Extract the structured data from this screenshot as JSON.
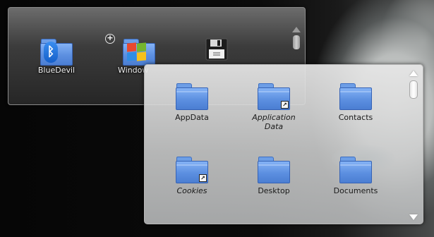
{
  "back_view": {
    "items": [
      {
        "label": "BlueDevil",
        "icon": "bluetooth-folder-icon"
      },
      {
        "label": "Window",
        "icon": "windows-folder-icon"
      },
      {
        "label": "",
        "icon": "floppy-disk-icon"
      }
    ],
    "add_badge": "+"
  },
  "front_view": {
    "items": [
      {
        "label": "AppData",
        "italic": false,
        "symlink": false
      },
      {
        "label": "Application Data",
        "italic": true,
        "symlink": true
      },
      {
        "label": "Contacts",
        "italic": false,
        "symlink": false
      },
      {
        "label": "Cookies",
        "italic": true,
        "symlink": true
      },
      {
        "label": "Desktop",
        "italic": false,
        "symlink": false
      },
      {
        "label": "Documents",
        "italic": false,
        "symlink": false
      }
    ],
    "symlink_badge": "↗"
  },
  "colors": {
    "folder_blue": "#5c8fe0",
    "panel_dark": "#262626",
    "panel_light": "#e6e6e6"
  }
}
